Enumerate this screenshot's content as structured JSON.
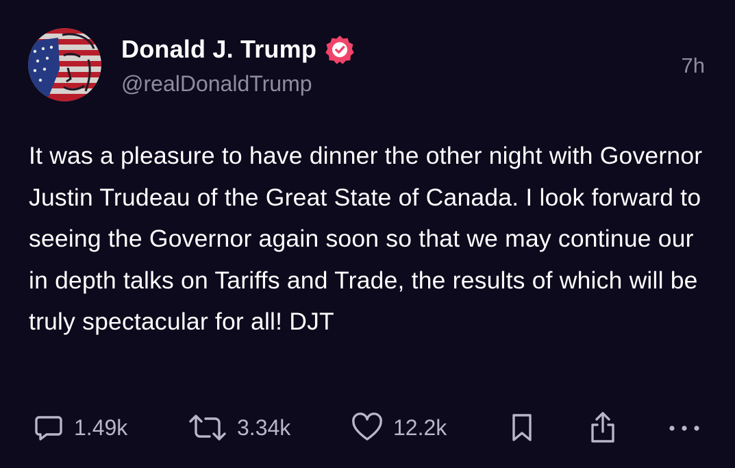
{
  "colors": {
    "background": "#0c0a1c",
    "text_primary": "#ffffff",
    "text_secondary": "#8f8c9e",
    "action_icon": "#b9b6c7",
    "verified_badge": "#f0446a"
  },
  "author": {
    "display_name": "Donald J. Trump",
    "handle": "@realDonaldTrump",
    "verified": true,
    "avatar_icon": "flag-portrait-avatar",
    "verified_icon": "verified-badge-icon"
  },
  "post": {
    "time_ago": "7h",
    "text": "It was a pleasure to have dinner the other night with Governor Justin Trudeau of the Great State of Canada. I look forward to seeing the Governor again soon so that we may continue our in depth talks on Tariffs and Trade, the results of which will be truly spectacular for all! DJT"
  },
  "actions": {
    "reply": {
      "icon": "reply-icon",
      "count": "1.49k"
    },
    "repost": {
      "icon": "repost-icon",
      "count": "3.34k"
    },
    "like": {
      "icon": "heart-icon",
      "count": "12.2k"
    },
    "bookmark": {
      "icon": "bookmark-icon"
    },
    "share": {
      "icon": "share-icon"
    },
    "more": {
      "icon": "more-icon"
    }
  }
}
